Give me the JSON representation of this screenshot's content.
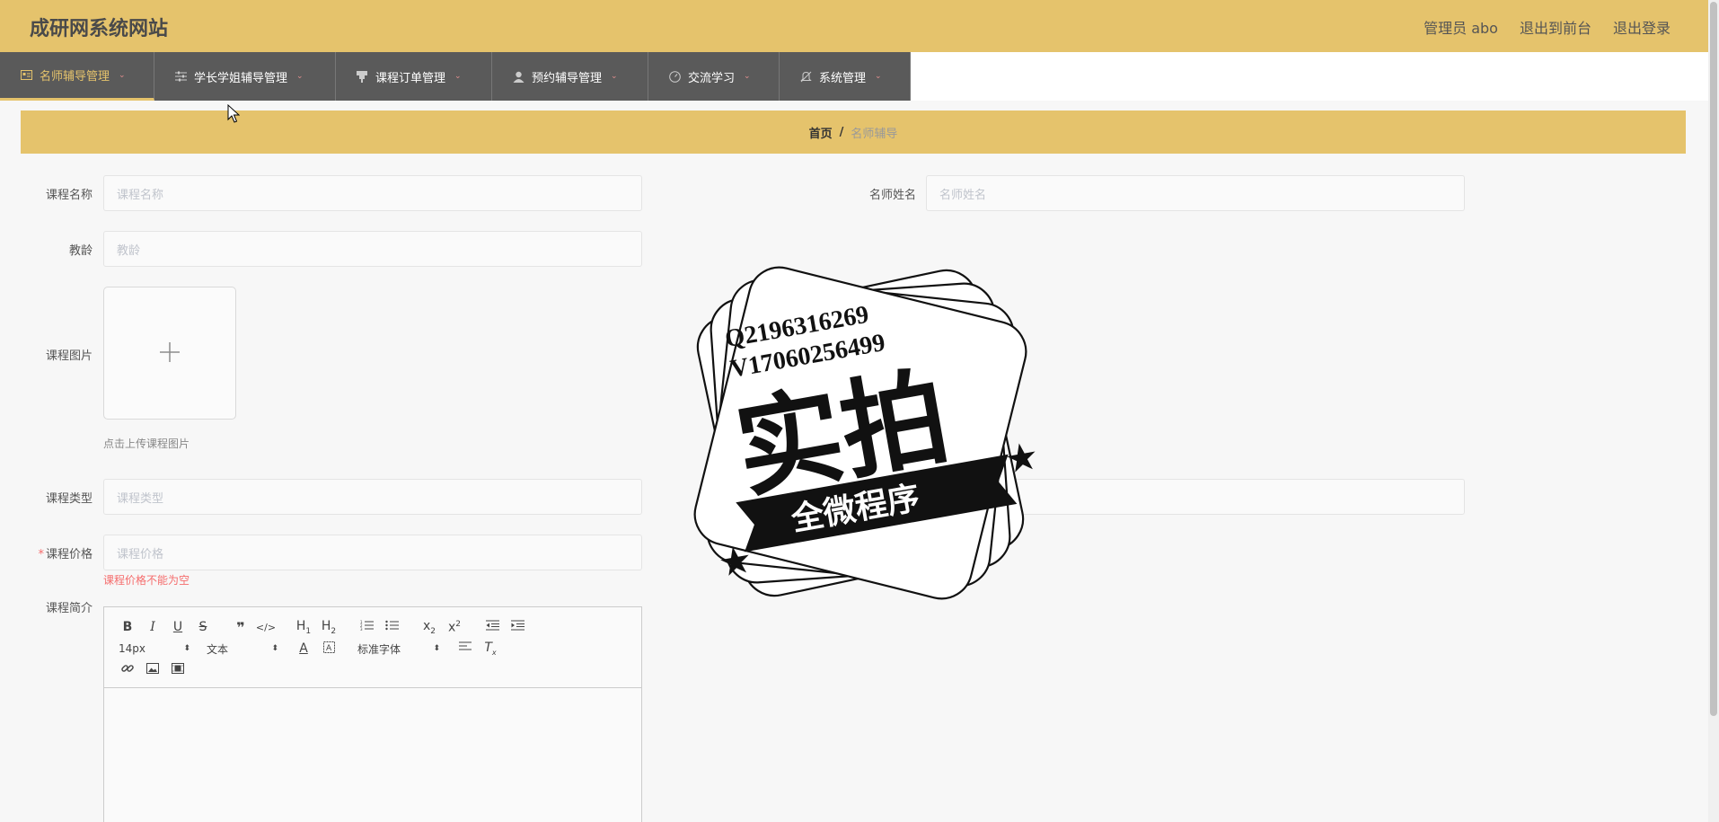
{
  "header": {
    "title": "成研网系统网站",
    "admin_label": "管理员 abo",
    "front_link": "退出到前台",
    "logout_link": "退出登录"
  },
  "nav": {
    "items": [
      {
        "label": "名师辅导管理",
        "icon": "card-icon"
      },
      {
        "label": "学长学姐辅导管理",
        "icon": "sliders-icon"
      },
      {
        "label": "课程订单管理",
        "icon": "stamp-icon"
      },
      {
        "label": "预约辅导管理",
        "icon": "user-icon"
      },
      {
        "label": "交流学习",
        "icon": "gauge-icon"
      },
      {
        "label": "系统管理",
        "icon": "bell-off-icon"
      }
    ]
  },
  "breadcrumb": {
    "home": "首页",
    "separator": "/",
    "current": "名师辅导"
  },
  "form": {
    "course_name_label": "课程名称",
    "course_name_placeholder": "课程名称",
    "teacher_name_label": "名师姓名",
    "teacher_name_placeholder": "名师姓名",
    "teaching_years_label": "教龄",
    "teaching_years_placeholder": "教龄",
    "course_image_label": "课程图片",
    "upload_hint": "点击上传课程图片",
    "course_type_label": "课程类型",
    "course_type_placeholder": "课程类型",
    "price_label": "课程价格",
    "price_placeholder": "课程价格",
    "price_error": "课程价格不能为空",
    "intro_label": "课程简介"
  },
  "editor": {
    "font_size": "14px",
    "format": "文本",
    "font_family": "标准字体"
  },
  "watermark": {
    "line1": "Q2196316269",
    "line2": "V17060256499",
    "big_text": "实拍",
    "banner_text": "全微程序"
  },
  "colors": {
    "accent": "#e5c36c",
    "nav_bg": "#5a5a5a",
    "error": "#f56c6c"
  }
}
